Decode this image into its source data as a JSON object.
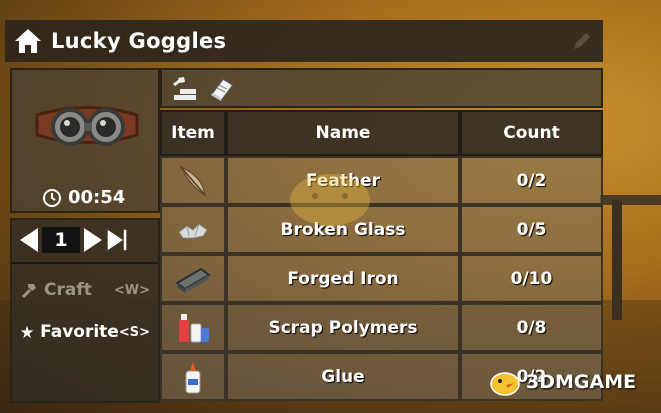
{
  "window": {
    "title": "Lucky Goggles"
  },
  "preview": {
    "timer": "00:54",
    "item_icon": "goggles-icon"
  },
  "controls": {
    "quantity": "1",
    "craft_label": "Craft",
    "craft_key": "<W>",
    "favorite_label": "Favorite",
    "favorite_key": "<S>"
  },
  "tabs": [
    {
      "icon": "crafting-bench-icon"
    },
    {
      "icon": "recipe-book-icon"
    }
  ],
  "table": {
    "headers": {
      "item": "Item",
      "name": "Name",
      "count": "Count"
    },
    "rows": [
      {
        "icon": "feather-icon",
        "name": "Feather",
        "count": "0/2"
      },
      {
        "icon": "broken-glass-icon",
        "name": "Broken Glass",
        "count": "0/5"
      },
      {
        "icon": "forged-iron-icon",
        "name": "Forged Iron",
        "count": "0/10"
      },
      {
        "icon": "scrap-polymers-icon",
        "name": "Scrap Polymers",
        "count": "0/8"
      },
      {
        "icon": "glue-icon",
        "name": "Glue",
        "count": "0/2"
      }
    ]
  },
  "watermark": {
    "text": "3DMGAME"
  },
  "colors": {
    "panel_dark": "#342e24",
    "panel_light": "#786e5c",
    "text": "#ffffff",
    "disabled_text": "#9a9486"
  }
}
